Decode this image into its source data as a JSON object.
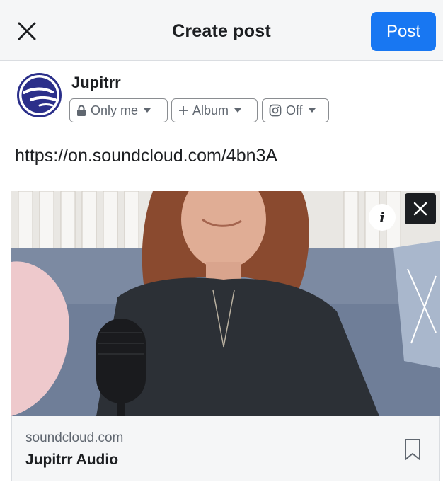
{
  "header": {
    "title": "Create post",
    "post_label": "Post",
    "close_icon": "close-icon",
    "accent": "#1877f2"
  },
  "profile": {
    "name": "Jupitrr",
    "privacy": {
      "label": "Only me",
      "icon": "lock-icon"
    },
    "album": {
      "label": "Album",
      "icon": "plus-icon"
    },
    "instagram": {
      "label": "Off",
      "icon": "instagram-icon"
    }
  },
  "post": {
    "text": "https://on.soundcloud.com/4bn3A"
  },
  "link_preview": {
    "info_label": "i",
    "domain": "soundcloud.com",
    "title": "Jupitrr Audio",
    "bookmark_icon": "bookmark-icon"
  }
}
